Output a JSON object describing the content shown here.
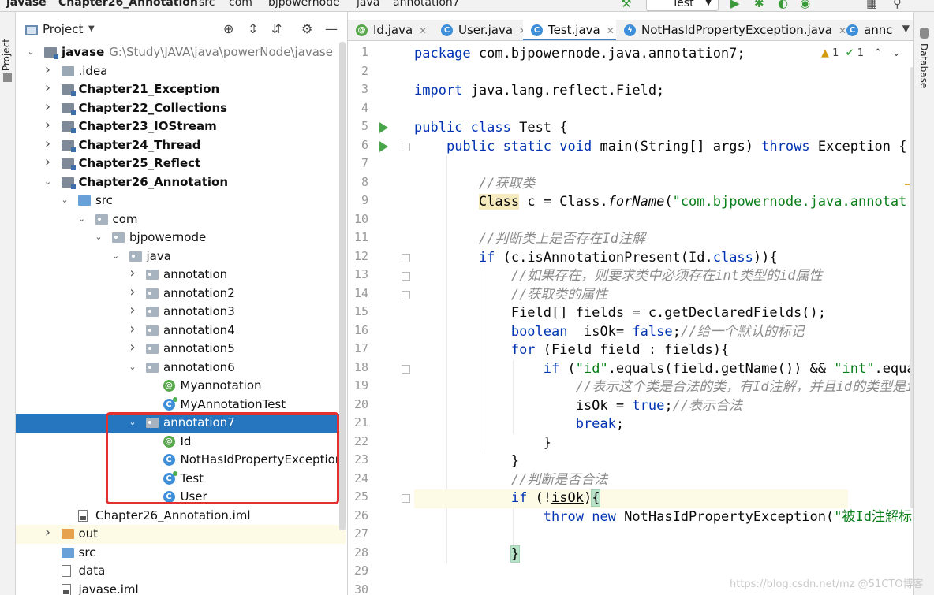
{
  "breadcrumb": [
    "javase",
    "Chapter26_Annotation",
    "src",
    "com",
    "bjpowernode",
    "java",
    "annotation7"
  ],
  "run_config": {
    "label": "Test"
  },
  "left_stripe": {
    "label": "Project"
  },
  "right_stripe": {
    "label": "Database"
  },
  "project": {
    "title": "Project",
    "tree": [
      {
        "label": "javase",
        "path": "G:\\Study\\JAVA\\java\\powerNode\\javase",
        "depth": 0,
        "state": "expanded",
        "icon": "module",
        "bold": true
      },
      {
        "label": ".idea",
        "depth": 1,
        "state": "collapsed",
        "icon": "folder"
      },
      {
        "label": "Chapter21_Exception",
        "depth": 1,
        "state": "collapsed",
        "icon": "module",
        "bold": true
      },
      {
        "label": "Chapter22_Collections",
        "depth": 1,
        "state": "collapsed",
        "icon": "module",
        "bold": true
      },
      {
        "label": "Chapter23_IOStream",
        "depth": 1,
        "state": "collapsed",
        "icon": "module",
        "bold": true
      },
      {
        "label": "Chapter24_Thread",
        "depth": 1,
        "state": "collapsed",
        "icon": "module",
        "bold": true
      },
      {
        "label": "Chapter25_Reflect",
        "depth": 1,
        "state": "collapsed",
        "icon": "module",
        "bold": true
      },
      {
        "label": "Chapter26_Annotation",
        "depth": 1,
        "state": "expanded",
        "icon": "module",
        "bold": true
      },
      {
        "label": "src",
        "depth": 2,
        "state": "expanded",
        "icon": "folder-blue"
      },
      {
        "label": "com",
        "depth": 3,
        "state": "expanded",
        "icon": "package"
      },
      {
        "label": "bjpowernode",
        "depth": 4,
        "state": "expanded",
        "icon": "package"
      },
      {
        "label": "java",
        "depth": 5,
        "state": "expanded",
        "icon": "package"
      },
      {
        "label": "annotation",
        "depth": 6,
        "state": "collapsed",
        "icon": "package"
      },
      {
        "label": "annotation2",
        "depth": 6,
        "state": "collapsed",
        "icon": "package"
      },
      {
        "label": "annotation3",
        "depth": 6,
        "state": "collapsed",
        "icon": "package"
      },
      {
        "label": "annotation4",
        "depth": 6,
        "state": "collapsed",
        "icon": "package"
      },
      {
        "label": "annotation5",
        "depth": 6,
        "state": "collapsed",
        "icon": "package"
      },
      {
        "label": "annotation6",
        "depth": 6,
        "state": "expanded",
        "icon": "package"
      },
      {
        "label": "Myannotation",
        "depth": 7,
        "state": "leaf",
        "icon": "annotation"
      },
      {
        "label": "MyAnnotationTest",
        "depth": 7,
        "state": "leaf",
        "icon": "test-class"
      },
      {
        "label": "annotation7",
        "depth": 6,
        "state": "expanded",
        "icon": "package",
        "selected": true
      },
      {
        "label": "Id",
        "depth": 7,
        "state": "leaf",
        "icon": "annotation"
      },
      {
        "label": "NotHasIdPropertyException",
        "depth": 7,
        "state": "leaf",
        "icon": "class"
      },
      {
        "label": "Test",
        "depth": 7,
        "state": "leaf",
        "icon": "test-class"
      },
      {
        "label": "User",
        "depth": 7,
        "state": "leaf",
        "icon": "class"
      },
      {
        "label": "Chapter26_Annotation.iml",
        "depth": 2,
        "state": "leaf",
        "icon": "file-dark"
      },
      {
        "label": "out",
        "depth": 1,
        "state": "collapsed",
        "icon": "folder-orange",
        "current": true
      },
      {
        "label": "src",
        "depth": 1,
        "state": "leaf",
        "icon": "folder-blue"
      },
      {
        "label": "data",
        "depth": 1,
        "state": "leaf",
        "icon": "file"
      },
      {
        "label": "javase.iml",
        "depth": 1,
        "state": "leaf",
        "icon": "file-dark"
      }
    ]
  },
  "editor": {
    "tabs": [
      {
        "label": "Id.java",
        "icon": "annotation",
        "active": false,
        "closable": true
      },
      {
        "label": "User.java",
        "icon": "class",
        "active": false,
        "closable": true
      },
      {
        "label": "Test.java",
        "icon": "test-class",
        "active": true,
        "closable": true
      },
      {
        "label": "NotHasIdPropertyException.java",
        "icon": "exception",
        "active": false,
        "closable": true
      },
      {
        "label": "annc",
        "icon": "class",
        "active": false,
        "closable": false
      }
    ],
    "inspections": {
      "warnings": "1",
      "weak_warnings": "1"
    },
    "line_numbers": [
      "1",
      "2",
      "3",
      "4",
      "5",
      "6",
      "7",
      "8",
      "9",
      "10",
      "11",
      "12",
      "13",
      "14",
      "15",
      "16",
      "17",
      "18",
      "19",
      "20",
      "21",
      "22",
      "23",
      "24",
      "25",
      "26",
      "27",
      "28",
      "29",
      "30"
    ],
    "current_line": 25,
    "run_markers": [
      5,
      6
    ],
    "fold_markers": [
      6,
      12,
      13,
      14,
      18,
      25
    ],
    "lines": [
      {
        "indent": 0,
        "tokens": [
          {
            "t": "package",
            "c": "kw"
          },
          {
            "t": " com.bjpowernode.java.annotation7;",
            "c": ""
          }
        ]
      },
      {
        "indent": 0,
        "tokens": []
      },
      {
        "indent": 0,
        "tokens": [
          {
            "t": "import",
            "c": "kw"
          },
          {
            "t": " java.lang.reflect.Field;",
            "c": ""
          }
        ]
      },
      {
        "indent": 0,
        "tokens": []
      },
      {
        "indent": 0,
        "tokens": [
          {
            "t": "public",
            "c": "kw"
          },
          {
            "t": " ",
            "c": ""
          },
          {
            "t": "class",
            "c": "kw"
          },
          {
            "t": " Test {",
            "c": ""
          }
        ]
      },
      {
        "indent": 1,
        "tokens": [
          {
            "t": "public",
            "c": "kw"
          },
          {
            "t": " ",
            "c": ""
          },
          {
            "t": "static",
            "c": "kw"
          },
          {
            "t": " ",
            "c": ""
          },
          {
            "t": "void",
            "c": "kw"
          },
          {
            "t": " main(String[] args) ",
            "c": ""
          },
          {
            "t": "throws",
            "c": "kw"
          },
          {
            "t": " Exception {",
            "c": ""
          }
        ]
      },
      {
        "indent": 0,
        "tokens": []
      },
      {
        "indent": 2,
        "tokens": [
          {
            "t": "//获取类",
            "c": "cmt"
          }
        ]
      },
      {
        "indent": 2,
        "tokens": [
          {
            "t": "Class",
            "c": "hlc"
          },
          {
            "t": " c = Class.",
            "c": ""
          },
          {
            "t": "forName",
            "c": "ital"
          },
          {
            "t": "(",
            "c": ""
          },
          {
            "t": "\"com.bjpowernode.java.annotat",
            "c": "str"
          }
        ]
      },
      {
        "indent": 0,
        "tokens": []
      },
      {
        "indent": 2,
        "tokens": [
          {
            "t": "//判断类上是否存在Id注解",
            "c": "cmt"
          }
        ]
      },
      {
        "indent": 2,
        "tokens": [
          {
            "t": "if",
            "c": "kw"
          },
          {
            "t": " (c.isAnnotationPresent(Id.",
            "c": ""
          },
          {
            "t": "class",
            "c": "kw"
          },
          {
            "t": ")){",
            "c": ""
          }
        ]
      },
      {
        "indent": 3,
        "tokens": [
          {
            "t": "//如果存在，则要求类中必须存在int类型的id属性",
            "c": "cmt"
          }
        ]
      },
      {
        "indent": 3,
        "tokens": [
          {
            "t": "//获取类的属性",
            "c": "cmt"
          }
        ]
      },
      {
        "indent": 3,
        "tokens": [
          {
            "t": "Field[] fields = c.getDeclaredFields();",
            "c": ""
          }
        ]
      },
      {
        "indent": 3,
        "tokens": [
          {
            "t": "boolean",
            "c": "kw"
          },
          {
            "t": "  ",
            "c": ""
          },
          {
            "t": "isOk",
            "c": "ul"
          },
          {
            "t": "= ",
            "c": ""
          },
          {
            "t": "false",
            "c": "kw"
          },
          {
            "t": ";",
            "c": ""
          },
          {
            "t": "//给一个默认的标记",
            "c": "cmt"
          }
        ]
      },
      {
        "indent": 3,
        "tokens": [
          {
            "t": "for",
            "c": "kw"
          },
          {
            "t": " (Field field : fields){",
            "c": ""
          }
        ]
      },
      {
        "indent": 4,
        "tokens": [
          {
            "t": "if",
            "c": "kw"
          },
          {
            "t": " (",
            "c": ""
          },
          {
            "t": "\"id\"",
            "c": "str"
          },
          {
            "t": ".equals(field.getName()) && ",
            "c": ""
          },
          {
            "t": "\"int\"",
            "c": "str"
          },
          {
            "t": ".equa",
            "c": ""
          }
        ]
      },
      {
        "indent": 5,
        "tokens": [
          {
            "t": "//表示这个类是合法的类，有Id注解，并且id的类型是i",
            "c": "cmt"
          }
        ]
      },
      {
        "indent": 5,
        "tokens": [
          {
            "t": "isOk",
            "c": "ul"
          },
          {
            "t": " = ",
            "c": ""
          },
          {
            "t": "true",
            "c": "kw"
          },
          {
            "t": ";",
            "c": ""
          },
          {
            "t": "//表示合法",
            "c": "cmt"
          }
        ]
      },
      {
        "indent": 5,
        "tokens": [
          {
            "t": "break",
            "c": "kw"
          },
          {
            "t": ";",
            "c": ""
          }
        ]
      },
      {
        "indent": 4,
        "tokens": [
          {
            "t": "}",
            "c": ""
          }
        ]
      },
      {
        "indent": 3,
        "tokens": [
          {
            "t": "}",
            "c": ""
          }
        ]
      },
      {
        "indent": 3,
        "tokens": [
          {
            "t": "//判断是否合法",
            "c": "cmt"
          }
        ]
      },
      {
        "indent": 3,
        "tokens": [
          {
            "t": "if",
            "c": "kw"
          },
          {
            "t": " (!",
            "c": ""
          },
          {
            "t": "isOk",
            "c": "ul"
          },
          {
            "t": ")",
            "c": ""
          },
          {
            "t": "{",
            "c": "brk"
          }
        ]
      },
      {
        "indent": 4,
        "tokens": [
          {
            "t": "throw",
            "c": "kw"
          },
          {
            "t": " ",
            "c": ""
          },
          {
            "t": "new",
            "c": "kw"
          },
          {
            "t": " NotHasIdPropertyException(",
            "c": ""
          },
          {
            "t": "\"被Id注解标",
            "c": "str"
          }
        ]
      },
      {
        "indent": 0,
        "tokens": []
      },
      {
        "indent": 3,
        "tokens": [
          {
            "t": "}",
            "c": "brk"
          }
        ]
      },
      {
        "indent": 0,
        "tokens": []
      },
      {
        "indent": 0,
        "tokens": []
      }
    ]
  },
  "watermark": "https://blog.csdn.net/mz @51CTO博客",
  "colors": {
    "selection": "#2675bf",
    "keyword": "#0033b3",
    "string": "#067d17",
    "comment": "#8c8c8c",
    "highlight_box": "#e53030"
  }
}
